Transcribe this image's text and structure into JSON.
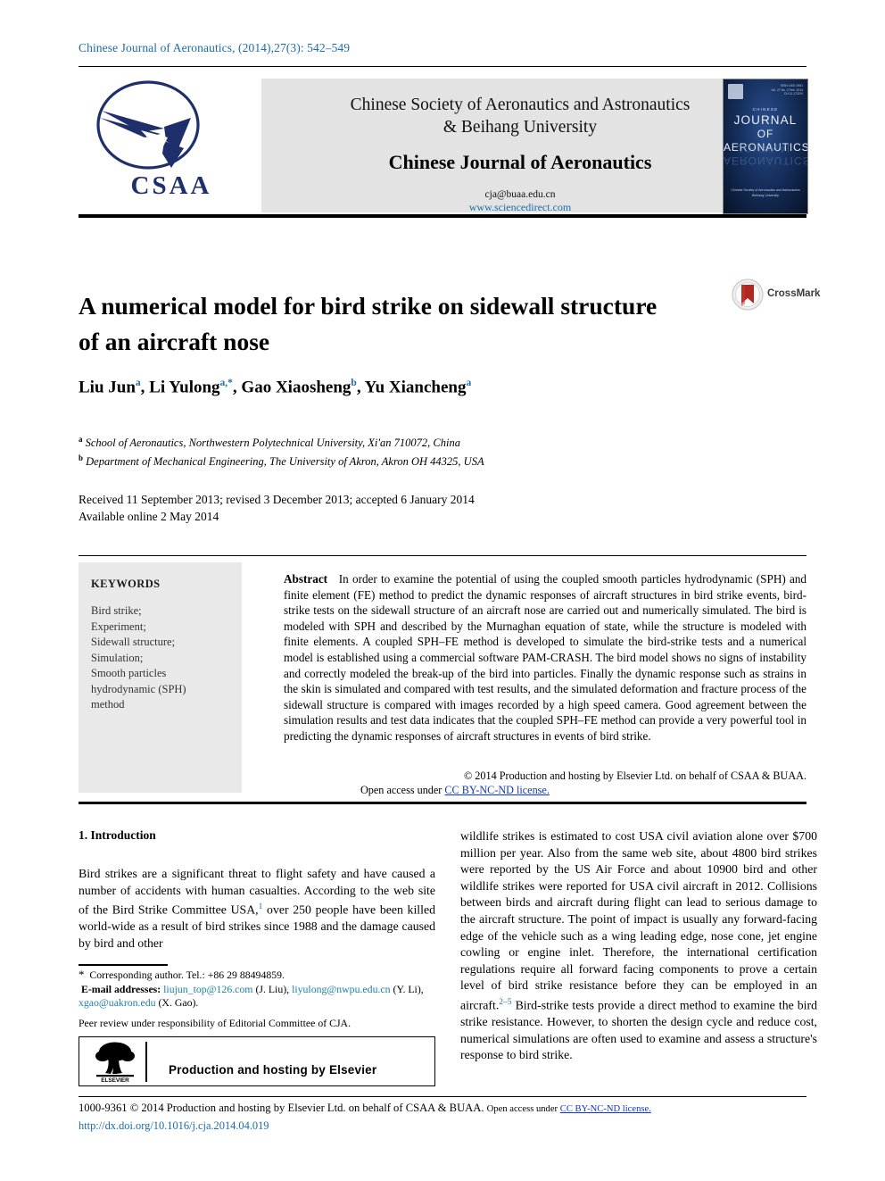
{
  "running_head": "Chinese Journal of Aeronautics, (2014),27(3): 542–549",
  "masthead": {
    "logo_text": "CSAA",
    "society_line1": "Chinese Society of Aeronautics and Astronautics",
    "society_line2": "& Beihang University",
    "journal_name": "Chinese Journal of Aeronautics",
    "email": "cja@buaa.edu.cn",
    "sciencedirect": "www.sciencedirect.com",
    "cover": {
      "chinese_label": "CHINESE",
      "title_line1": "JOURNAL",
      "title_line2": "OF",
      "title_line3": "AERONAUTICS",
      "corner_info": "ISSN 1000-9361\nVol. 27 No. 3 February 2014\nCN 11-1732/V",
      "footer_line1": "Chinese Society of Aeronautics and Astronautics",
      "footer_line2": "Beihang University"
    }
  },
  "article": {
    "title": "A numerical model for bird strike on sidewall structure of an aircraft nose",
    "crossmark_label": "CrossMark",
    "authors": [
      {
        "name": "Liu Jun",
        "sup": "a"
      },
      {
        "name": "Li Yulong",
        "sup": "a,*"
      },
      {
        "name": "Gao Xiaosheng",
        "sup": "b"
      },
      {
        "name": "Yu Xiancheng",
        "sup": "a"
      }
    ],
    "affiliations": [
      {
        "marker": "a",
        "text": "School of Aeronautics, Northwestern Polytechnical University, Xi'an 710072, China"
      },
      {
        "marker": "b",
        "text": "Department of Mechanical Engineering, The University of Akron, Akron OH 44325, USA"
      }
    ],
    "history_line1": "Received 11 September 2013; revised 3 December 2013; accepted 6 January 2014",
    "history_line2": "Available online 2 May 2014"
  },
  "keywords": {
    "heading": "KEYWORDS",
    "items": [
      "Bird strike;",
      "Experiment;",
      "Sidewall structure;",
      "Simulation;",
      "Smooth particles",
      "hydrodynamic (SPH)",
      "method"
    ]
  },
  "abstract": {
    "label": "Abstract",
    "text": "In order to examine the potential of using the coupled smooth particles hydrodynamic (SPH) and finite element (FE) method to predict the dynamic responses of aircraft structures in bird strike events, bird-strike tests on the sidewall structure of an aircraft nose are carried out and numerically simulated. The bird is modeled with SPH and described by the Murnaghan equation of state, while the structure is modeled with finite elements. A coupled SPH–FE method is developed to simulate the bird-strike tests and a numerical model is established using a commercial software PAM-CRASH. The bird model shows no signs of instability and correctly modeled the break-up of the bird into particles. Finally the dynamic response such as strains in the skin is simulated and compared with test results, and the simulated deformation and fracture process of the sidewall structure is compared with images recorded by a high speed camera. Good agreement between the simulation results and test data indicates that the coupled SPH–FE method can provide a very powerful tool in predicting the dynamic responses of aircraft structures in events of bird strike.",
    "copyright": "© 2014 Production and hosting by Elsevier Ltd. on behalf of CSAA & BUAA.",
    "open_access_prefix": "Open access under ",
    "license_link": "CC BY-NC-ND license."
  },
  "introduction": {
    "heading": "1. Introduction",
    "left_col_part1": "Bird strikes are a significant threat to flight safety and have caused a number of accidents with human casualties. According to the web site of the Bird Strike Committee USA,",
    "left_ref1": "1",
    "left_col_part2": " over 250 people have been killed world-wide as a result of bird strikes since 1988 and the damage caused by bird and other",
    "right_col_part1": "wildlife strikes is estimated to cost USA civil aviation alone over $700 million per year. Also from the same web site, about 4800 bird strikes were reported by the US Air Force and about 10900 bird and other wildlife strikes were reported for USA civil aircraft in 2012. Collisions between birds and aircraft during flight can lead to serious damage to the aircraft structure. The point of impact is usually any forward-facing edge of the vehicle such as a wing leading edge, nose cone, jet engine cowling or engine inlet. Therefore, the international certification regulations require all forward facing components to prove a certain level of bird strike resistance before they can be employed in an aircraft.",
    "right_ref1": "2–5",
    "right_col_part2": " Bird-strike tests provide a direct method to examine the bird strike resistance. However, to shorten the design cycle and reduce cost, numerical simulations are often used to examine and assess a structure's response to bird strike."
  },
  "footnotes": {
    "corresponding": "Corresponding author. Tel.: +86 29 88494859.",
    "email_label": "E-mail addresses:",
    "email1": "liujun_top@126.com",
    "email1_owner": "(J. Liu),",
    "email2": "liyulong@nwpu.edu.cn",
    "email2_owner": "(Y. Li),",
    "email3": "xgao@uakron.edu",
    "email3_owner": "(X. Gao).",
    "peer_review": "Peer review under responsibility of Editorial Committee of CJA.",
    "elsevier_box_text": "Production and hosting by Elsevier",
    "elsevier_logo_word": "ELSEVIER"
  },
  "page_footer": {
    "issn_copyright": "1000-9361 © 2014 Production and hosting by Elsevier Ltd. on behalf of CSAA & BUAA.",
    "open_access_prefix": "Open access under ",
    "license_link": "CC BY-NC-ND license.",
    "doi": "http://dx.doi.org/10.1016/j.cja.2014.04.019"
  },
  "colors": {
    "link_blue": "#1b6ca8",
    "license_blue": "#1038c4",
    "keyword_box": "#e9e9e9",
    "masthead_band": "#e3e3e3",
    "logo_navy": "#1f2f6b",
    "crossmark_red": "#b3281e"
  }
}
